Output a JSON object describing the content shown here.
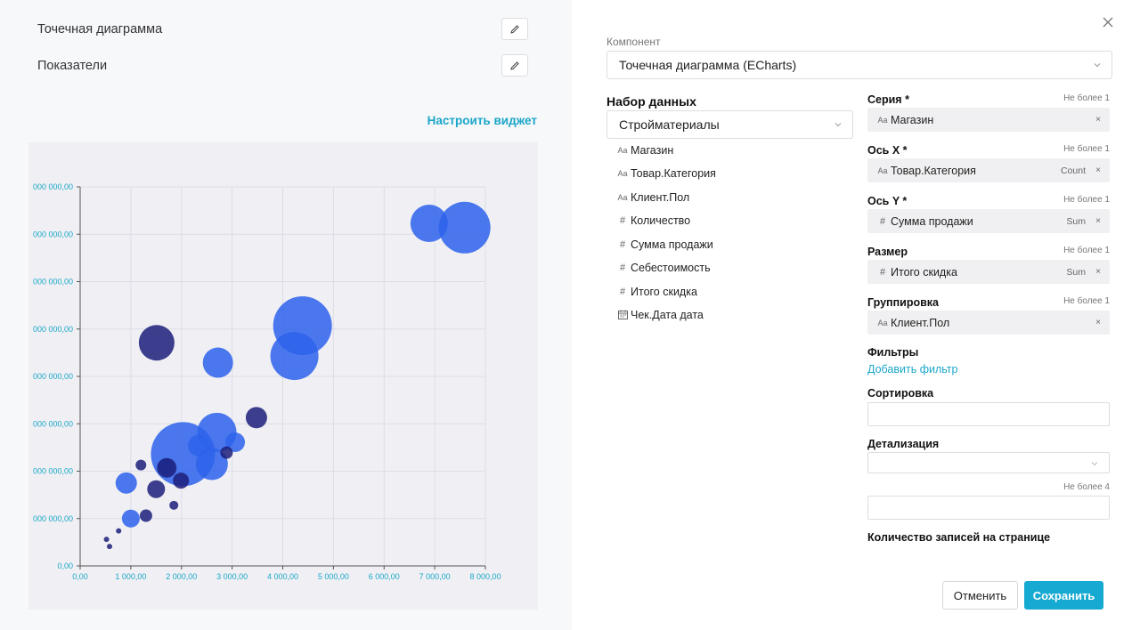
{
  "left": {
    "rows": [
      "Точечная диаграмма",
      "Показатели"
    ],
    "configure_link": "Настроить виджет"
  },
  "chart_data": {
    "type": "scatter",
    "xlim": [
      0,
      8000
    ],
    "ylim": [
      0,
      8000000
    ],
    "x_ticks": [
      "0,00",
      "1 000,00",
      "2 000,00",
      "3 000,00",
      "4 000,00",
      "5 000,00",
      "6 000,00",
      "7 000,00",
      "8 000,00"
    ],
    "y_ticks": [
      "0,00",
      "000 000,00",
      "000 000,00",
      "000 000,00",
      "000 000,00",
      "000 000,00",
      "000 000,00",
      "000 000,00",
      "000 000,00"
    ],
    "grid": true,
    "colors": [
      "#2d62eb",
      "#1c1e7a"
    ],
    "series": [
      {
        "color": "#2d62eb",
        "points": [
          {
            "x": 6890,
            "y": 7230000,
            "size": 21
          },
          {
            "x": 7590,
            "y": 7140000,
            "size": 29
          },
          {
            "x": 4390,
            "y": 5070000,
            "size": 33
          },
          {
            "x": 4230,
            "y": 4430000,
            "size": 27
          },
          {
            "x": 2720,
            "y": 4290000,
            "size": 17
          },
          {
            "x": 2700,
            "y": 2820000,
            "size": 22
          },
          {
            "x": 2030,
            "y": 2360000,
            "size": 36
          },
          {
            "x": 2340,
            "y": 2540000,
            "size": 12
          },
          {
            "x": 3060,
            "y": 2610000,
            "size": 11
          },
          {
            "x": 2600,
            "y": 2150000,
            "size": 18
          },
          {
            "x": 1700,
            "y": 2110000,
            "size": 9
          },
          {
            "x": 910,
            "y": 1750000,
            "size": 12
          },
          {
            "x": 1000,
            "y": 1000000,
            "size": 10
          }
        ]
      },
      {
        "color": "#1c1e7a",
        "points": [
          {
            "x": 1510,
            "y": 4710000,
            "size": 20
          },
          {
            "x": 3480,
            "y": 3130000,
            "size": 12
          },
          {
            "x": 2890,
            "y": 2390000,
            "size": 7
          },
          {
            "x": 1710,
            "y": 2070000,
            "size": 11
          },
          {
            "x": 1200,
            "y": 2130000,
            "size": 6
          },
          {
            "x": 1500,
            "y": 1620000,
            "size": 10
          },
          {
            "x": 1990,
            "y": 1800000,
            "size": 9
          },
          {
            "x": 1300,
            "y": 1060000,
            "size": 7
          },
          {
            "x": 1850,
            "y": 1280000,
            "size": 5
          },
          {
            "x": 760,
            "y": 740000,
            "size": 3
          },
          {
            "x": 520,
            "y": 560000,
            "size": 3
          },
          {
            "x": 580,
            "y": 410000,
            "size": 3
          }
        ]
      }
    ]
  },
  "panel": {
    "component_label": "Компонент",
    "component_value": "Точечная диаграмма (ECharts)",
    "dataset_title": "Набор данных",
    "dataset_value": "Стройматериалы",
    "fields": [
      {
        "icon": "Aa",
        "label": "Магазин"
      },
      {
        "icon": "Aa",
        "label": "Товар.Категория"
      },
      {
        "icon": "Aa",
        "label": "Клиент.Пол"
      },
      {
        "icon": "#",
        "label": "Количество"
      },
      {
        "icon": "#",
        "label": "Сумма продажи"
      },
      {
        "icon": "#",
        "label": "Себестоимость"
      },
      {
        "icon": "#",
        "label": "Итого скидка"
      },
      {
        "icon": "calendar",
        "label": "Чек.Дата дата"
      }
    ],
    "series_label": "Серия *",
    "series_limit": "Не более 1",
    "series_chip": {
      "icon": "Aa",
      "label": "Магазин",
      "agg": "",
      "remove": "×"
    },
    "x_label": "Ось X *",
    "x_limit": "Не более 1",
    "x_chip": {
      "icon": "Aa",
      "label": "Товар.Категория",
      "agg": "Count",
      "remove": "×"
    },
    "y_label": "Ось Y *",
    "y_limit": "Не более 1",
    "y_chip": {
      "icon": "#",
      "label": "Сумма продажи",
      "agg": "Sum",
      "remove": "×"
    },
    "size_label": "Размер",
    "size_limit": "Не более 1",
    "size_chip": {
      "icon": "#",
      "label": "Итого скидка",
      "agg": "Sum",
      "remove": "×"
    },
    "group_label": "Группировка",
    "group_limit": "Не более 1",
    "group_chip": {
      "icon": "Aa",
      "label": "Клиент.Пол",
      "agg": "",
      "remove": "×"
    },
    "filters_label": "Фильтры",
    "add_filter": "Добавить фильтр",
    "sort_label": "Сортировка",
    "detail_label": "Детализация",
    "detail_limit": "Не более 4",
    "records_label": "Количество записей на странице",
    "cancel": "Отменить",
    "save": "Сохранить"
  }
}
